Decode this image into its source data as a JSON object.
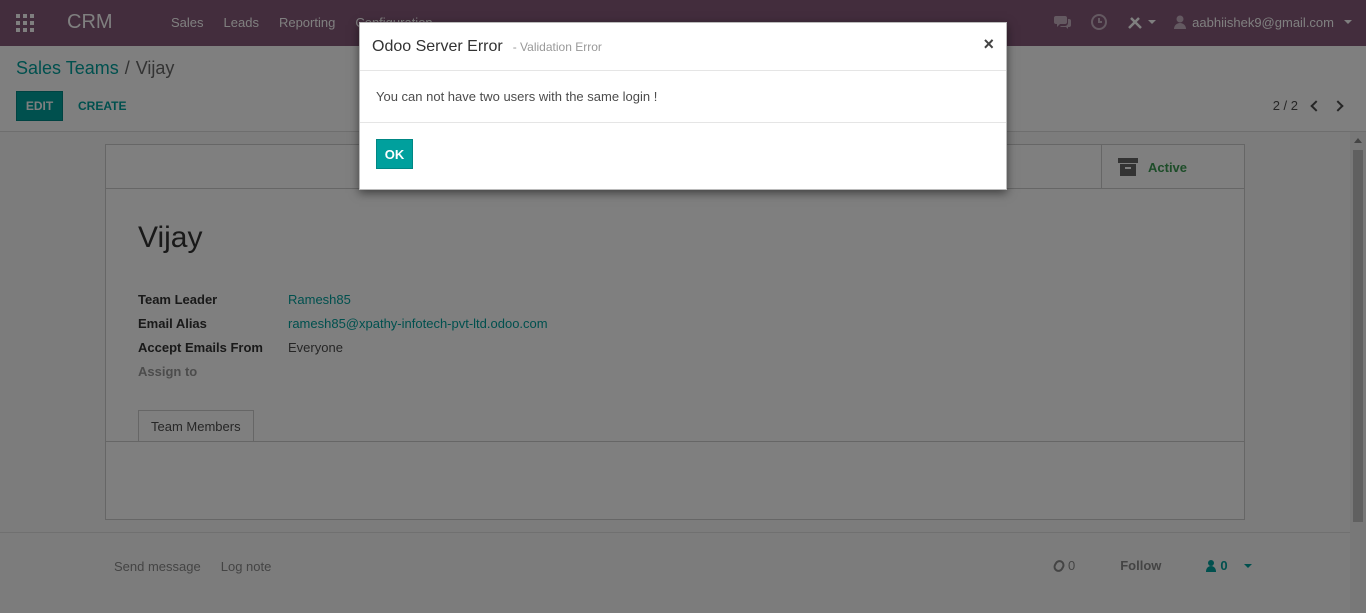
{
  "navbar": {
    "brand": "CRM",
    "menu": [
      {
        "label": "Sales"
      },
      {
        "label": "Leads"
      },
      {
        "label": "Reporting"
      },
      {
        "label": "Configuration"
      }
    ],
    "user": "aabhiishek9@gmail.com",
    "bg_color": "#875a7b"
  },
  "breadcrumb": {
    "parent": "Sales Teams",
    "separator": "/",
    "current": "Vijay"
  },
  "toolbar": {
    "edit_label": "EDIT",
    "create_label": "CREATE"
  },
  "pager": {
    "value": "2 / 2"
  },
  "record": {
    "status": "Active",
    "title": "Vijay",
    "fields": [
      {
        "label": "Team Leader",
        "value": "Ramesh85"
      },
      {
        "label": "Email Alias",
        "value": "ramesh85@xpathy-infotech-pvt-ltd.odoo.com"
      },
      {
        "label": "Accept Emails From",
        "value": "Everyone"
      },
      {
        "label": "Assign to",
        "value": ""
      }
    ],
    "tab": "Team Members"
  },
  "chatter": {
    "send_message": "Send message",
    "log_note": "Log note",
    "attachments_count": "0",
    "follow": "Follow",
    "followers_count": "0"
  },
  "modal": {
    "title": "Odoo Server Error",
    "subtitle": "- Validation Error",
    "close": "×",
    "message": "You can not have two users with the same login !",
    "ok_label": "OK"
  },
  "colors": {
    "accent": "#00a09d",
    "active_status": "#3a9a52"
  }
}
